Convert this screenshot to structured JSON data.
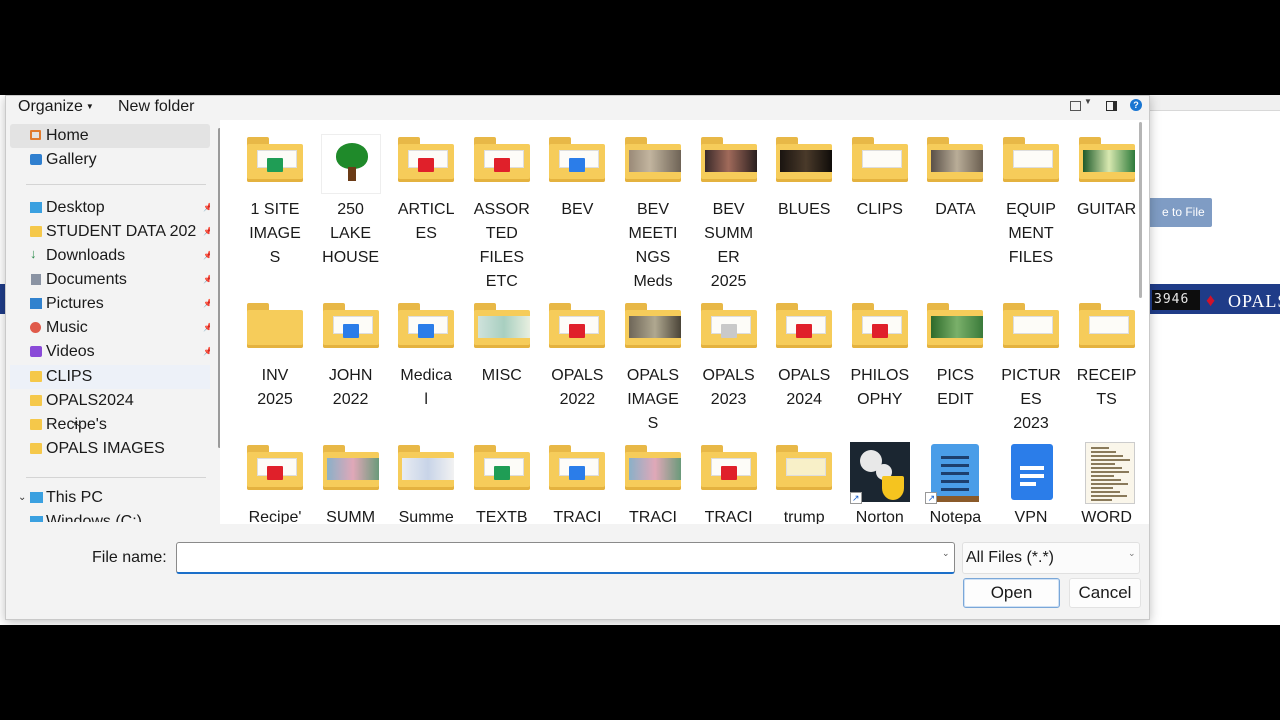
{
  "background_app": {
    "button_label": "e to File",
    "counter": "3946",
    "brand": "OPALS"
  },
  "toolbar": {
    "organize_label": "Organize",
    "new_folder_label": "New folder"
  },
  "nav": {
    "items": [
      {
        "label": "Home",
        "icon": "home-icon"
      },
      {
        "label": "Gallery",
        "icon": "gallery-icon"
      },
      {
        "label": "Desktop",
        "icon": "desktop-icon"
      },
      {
        "label": "STUDENT DATA 202",
        "icon": "folder-icon"
      },
      {
        "label": "Downloads",
        "icon": "download-icon"
      },
      {
        "label": "Documents",
        "icon": "documents-icon"
      },
      {
        "label": "Pictures",
        "icon": "pictures-icon"
      },
      {
        "label": "Music",
        "icon": "music-icon"
      },
      {
        "label": "Videos",
        "icon": "videos-icon"
      },
      {
        "label": "CLIPS",
        "icon": "folder-icon"
      },
      {
        "label": "OPALS2024",
        "icon": "folder-icon"
      },
      {
        "label": "Recipe's",
        "icon": "folder-icon"
      },
      {
        "label": "OPALS IMAGES",
        "icon": "folder-icon"
      },
      {
        "label": "This PC",
        "icon": "this-pc-icon"
      },
      {
        "label": "Windows (C:)",
        "icon": "drive-icon"
      }
    ]
  },
  "files": [
    {
      "name": "1 SITE\nIMAGE\nS",
      "kind": "folder",
      "badge": "sheet"
    },
    {
      "name": "250\nLAKE\nHOUSE",
      "kind": "image-tree"
    },
    {
      "name": "ARTICL\nES",
      "kind": "folder",
      "badge": "pdf"
    },
    {
      "name": "ASSOR\nTED\nFILES\nETC",
      "kind": "folder",
      "badge": "pdf"
    },
    {
      "name": "BEV",
      "kind": "folder",
      "badge": "word"
    },
    {
      "name": "BEV\nMEETI\nNGS\nMeds",
      "kind": "folder",
      "badge": "photo-gray"
    },
    {
      "name": "BEV\nSUMM\nER\n2025",
      "kind": "folder",
      "badge": "photo-dark"
    },
    {
      "name": "BLUES",
      "kind": "folder",
      "badge": "photo-black"
    },
    {
      "name": "CLIPS",
      "kind": "folder",
      "badge": "paper"
    },
    {
      "name": "DATA",
      "kind": "folder",
      "badge": "photo-room"
    },
    {
      "name": "EQUIP\nMENT\nFILES",
      "kind": "folder",
      "badge": "paper"
    },
    {
      "name": "GUITAR",
      "kind": "folder",
      "badge": "photo-green"
    },
    {
      "name": "INV\n2025",
      "kind": "folder",
      "badge": "none"
    },
    {
      "name": "JOHN\n2022",
      "kind": "folder",
      "badge": "word"
    },
    {
      "name": "Medica\nl",
      "kind": "folder",
      "badge": "word"
    },
    {
      "name": "MISC",
      "kind": "folder",
      "badge": "photo-teal"
    },
    {
      "name": "OPALS\n2022",
      "kind": "folder",
      "badge": "pdf"
    },
    {
      "name": "OPALS\nIMAGE\nS",
      "kind": "folder",
      "badge": "photo-script"
    },
    {
      "name": "OPALS\n2023",
      "kind": "folder",
      "badge": "generic"
    },
    {
      "name": "OPALS\n2024",
      "kind": "folder",
      "badge": "pdf"
    },
    {
      "name": "PHILOS\nOPHY",
      "kind": "folder",
      "badge": "pdf"
    },
    {
      "name": "PICS\nEDIT",
      "kind": "folder",
      "badge": "photo-leaf"
    },
    {
      "name": "PICTUR\nES\n2023",
      "kind": "folder",
      "badge": "paper"
    },
    {
      "name": "RECEIP\nTS",
      "kind": "folder",
      "badge": "paper"
    },
    {
      "name": "Recipe'",
      "kind": "folder",
      "badge": "pdf"
    },
    {
      "name": "SUMM",
      "kind": "folder",
      "badge": "photo-pink"
    },
    {
      "name": "Summe",
      "kind": "folder",
      "badge": "photo-blue"
    },
    {
      "name": "TEXTB",
      "kind": "folder",
      "badge": "sheet"
    },
    {
      "name": "TRACI",
      "kind": "folder",
      "badge": "word"
    },
    {
      "name": "TRACI",
      "kind": "folder",
      "badge": "photo-pink"
    },
    {
      "name": "TRACI",
      "kind": "folder",
      "badge": "pdf"
    },
    {
      "name": "trump",
      "kind": "folder",
      "badge": "paper-yellow"
    },
    {
      "name": "Norton",
      "kind": "app-norton"
    },
    {
      "name": "Notepa",
      "kind": "app-notepad"
    },
    {
      "name": "VPN",
      "kind": "app-vpn"
    },
    {
      "name": "WORD",
      "kind": "doc-word"
    }
  ],
  "footer": {
    "file_name_label": "File name:",
    "file_name_value": "",
    "filter_value": "All Files (*.*)",
    "open_label": "Open",
    "cancel_label": "Cancel"
  },
  "colors": {
    "folder": "#f6cc5a",
    "accent": "#1b6fc9",
    "pdf": "#e0202a",
    "word": "#2b7de9",
    "sheet": "#1f9d55"
  }
}
